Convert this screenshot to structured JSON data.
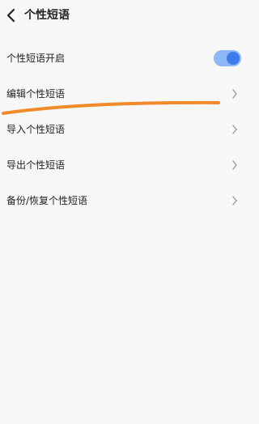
{
  "header": {
    "title": "个性短语"
  },
  "settings": {
    "items": [
      {
        "label": "个性短语开启",
        "type": "toggle",
        "enabled": true
      },
      {
        "label": "编辑个性短语",
        "type": "link"
      },
      {
        "label": "导入个性短语",
        "type": "link"
      },
      {
        "label": "导出个性短语",
        "type": "link"
      },
      {
        "label": "备份/恢复个性短语",
        "type": "link"
      }
    ]
  },
  "colors": {
    "toggle_on": "#3b7bea",
    "annotation_stroke": "#f08a2a"
  }
}
